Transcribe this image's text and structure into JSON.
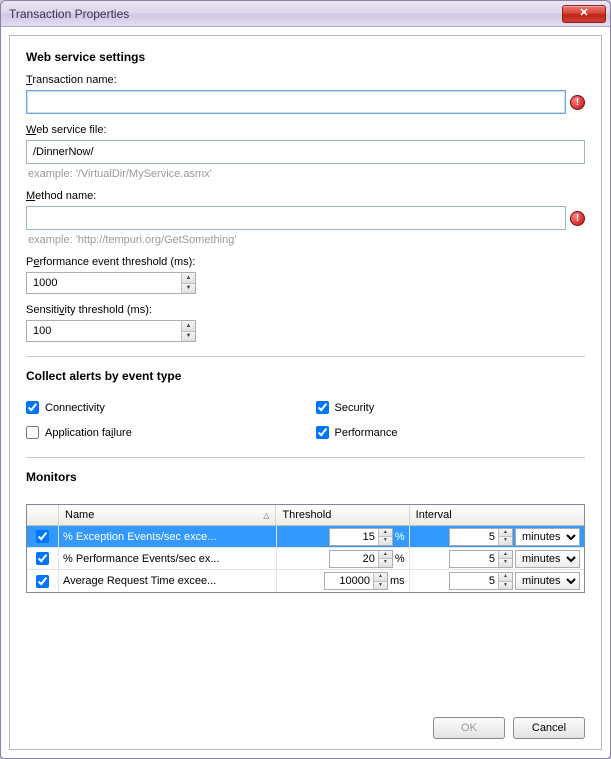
{
  "titlebar": {
    "title": "Transaction Properties"
  },
  "sections": {
    "web_service": "Web service settings",
    "collect_alerts": "Collect alerts by event type",
    "monitors": "Monitors"
  },
  "labels": {
    "transaction_name": "Transaction name:",
    "web_service_file": "Web service file:",
    "method_name": "Method name:",
    "perf_event_threshold": "Performance event threshold (ms):",
    "sensitivity_threshold": "Sensitivity threshold (ms):"
  },
  "values": {
    "transaction_name": "",
    "web_service_file": "/DinnerNow/",
    "method_name": "",
    "perf_event_threshold": "1000",
    "sensitivity_threshold": "100"
  },
  "examples": {
    "web_service_file": "example: '/VirtualDir/MyService.asmx'",
    "method_name": "example: 'http://tempuri.org/GetSomething'"
  },
  "checkboxes": {
    "connectivity": {
      "label": "Connectivity",
      "checked": true
    },
    "security": {
      "label": "Security",
      "checked": true
    },
    "app_failure": {
      "label": "Application failure",
      "checked": false
    },
    "performance": {
      "label": "Performance",
      "checked": true
    }
  },
  "monitors_table": {
    "headers": {
      "name": "Name",
      "threshold": "Threshold",
      "interval": "Interval"
    },
    "rows": [
      {
        "checked": true,
        "name": "% Exception Events/sec exce...",
        "threshold": "15",
        "threshold_unit": "%",
        "interval": "5",
        "interval_unit": "minutes",
        "selected": true
      },
      {
        "checked": true,
        "name": "% Performance Events/sec ex...",
        "threshold": "20",
        "threshold_unit": "%",
        "interval": "5",
        "interval_unit": "minutes",
        "selected": false
      },
      {
        "checked": true,
        "name": "Average Request Time excee...",
        "threshold": "10000",
        "threshold_unit": "ms",
        "interval": "5",
        "interval_unit": "minutes",
        "selected": false
      }
    ]
  },
  "buttons": {
    "ok": "OK",
    "cancel": "Cancel"
  },
  "close_glyph": "✕"
}
